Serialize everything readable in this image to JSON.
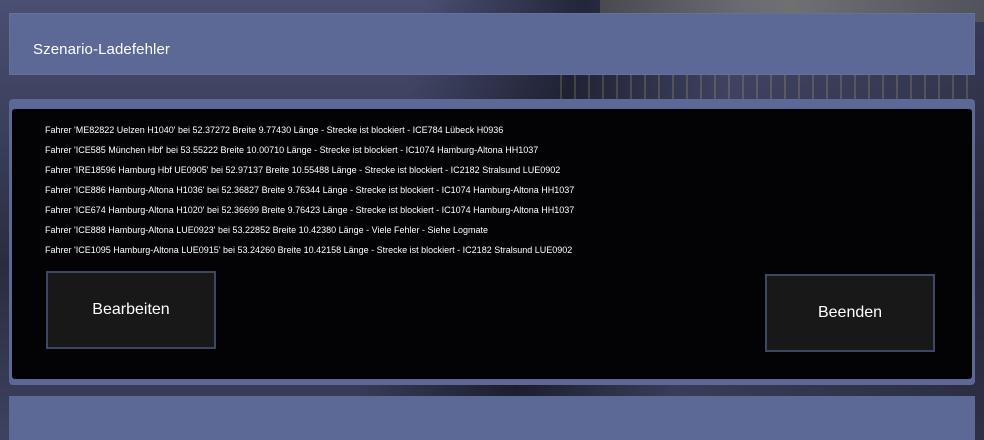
{
  "dialog": {
    "title": "Szenario-Ladefehler",
    "log_lines": [
      "Fahrer 'ME82822 Uelzen H1040' bei 52.37272 Breite 9.77430 Länge - Strecke ist blockiert - ICE784 Lübeck H0936",
      "Fahrer 'ICE585 München Hbf' bei 53.55222 Breite 10.00710 Länge - Strecke ist blockiert - IC1074 Hamburg-Altona HH1037",
      "Fahrer 'IRE18596 Hamburg Hbf UE0905' bei 52.97137 Breite 10.55488 Länge - Strecke ist blockiert - IC2182 Stralsund LUE0902",
      "Fahrer 'ICE886 Hamburg-Altona H1036' bei 52.36827 Breite 9.76344 Länge - Strecke ist blockiert - IC1074 Hamburg-Altona HH1037",
      "Fahrer 'ICE674 Hamburg-Altona H1020' bei 52.36699 Breite 9.76423 Länge - Strecke ist blockiert - IC1074 Hamburg-Altona HH1037",
      "Fahrer 'ICE888 Hamburg-Altona LUE0923' bei 53.22852 Breite 10.42380 Länge - Viele Fehler - Siehe Logmate",
      "Fahrer 'ICE1095 Hamburg-Altona LUE0915' bei 53.24260 Breite 10.42158 Länge - Strecke ist blockiert - IC2182 Stralsund LUE0902"
    ],
    "edit_button": "Bearbeiten",
    "quit_button": "Beenden"
  },
  "colors": {
    "bar": "#5c6895",
    "panel": "#030305",
    "button_bg": "#181818",
    "button_border": "#3d4763",
    "text": "#ffffff"
  }
}
